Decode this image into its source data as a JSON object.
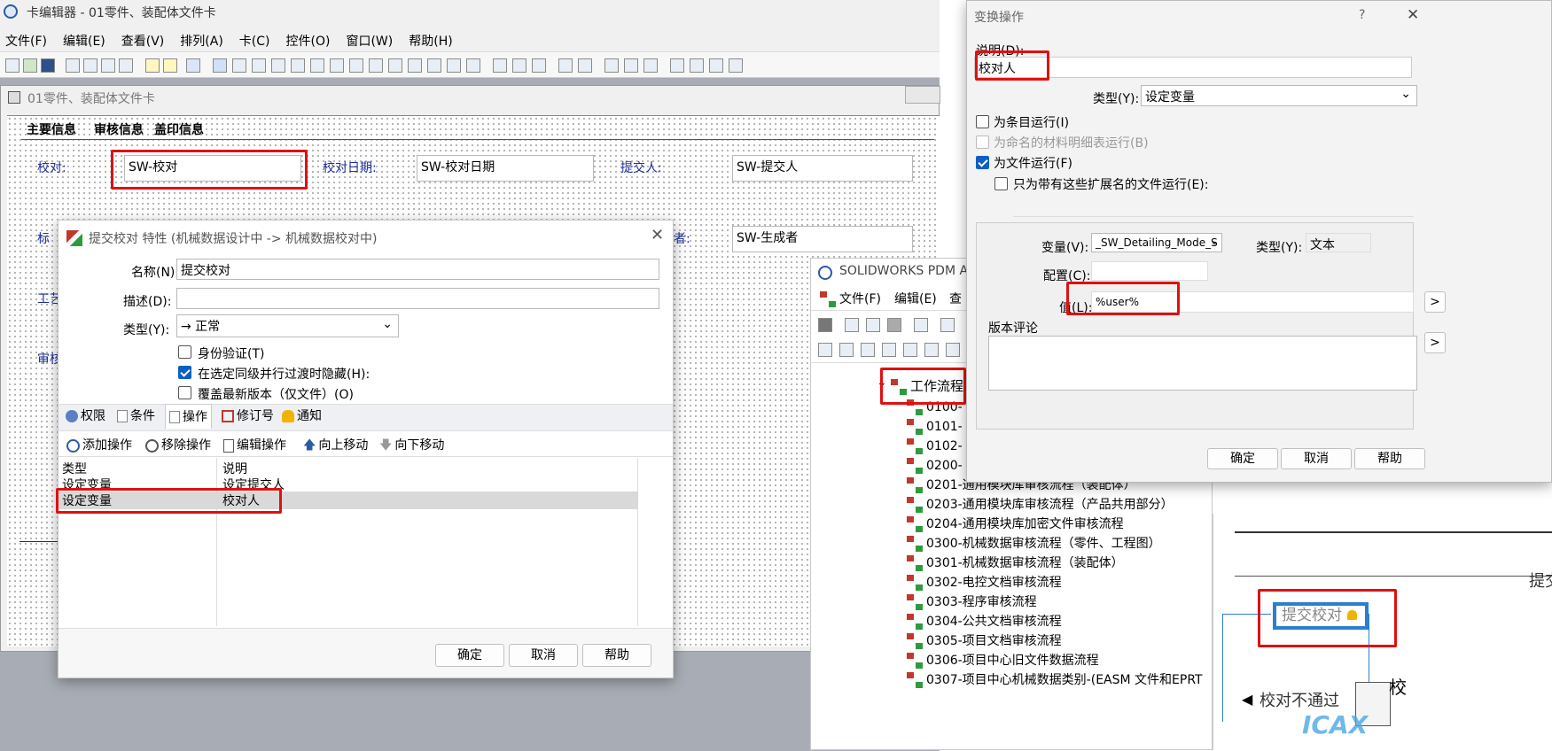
{
  "main_window": {
    "title": "卡编辑器 - 01零件、装配体文件卡",
    "menu": [
      "文件(F)",
      "编辑(E)",
      "查看(V)",
      "排列(A)",
      "卡(C)",
      "控件(O)",
      "窗口(W)",
      "帮助(H)"
    ],
    "inner_title": "01零件、装配体文件卡"
  },
  "card": {
    "tabs": [
      "主要信息",
      "审核信息",
      "盖印信息"
    ],
    "fields": [
      {
        "label": "校对:",
        "value": "SW-校对"
      },
      {
        "label": "校对日期:",
        "value": "SW-校对日期"
      },
      {
        "label": "提交人:",
        "value": "SW-提交人"
      },
      {
        "label": "标",
        "value": ""
      },
      {
        "label": "者:",
        "value": "SW-生成者"
      },
      {
        "label": "工艺",
        "value": ""
      },
      {
        "label": "审核",
        "value": ""
      }
    ]
  },
  "transition_dialog": {
    "title": "提交校对 特性 (机械数据设计中 -> 机械数据校对中)",
    "name_label": "名称(N):",
    "name_value": "提交校对",
    "desc_label": "描述(D):",
    "desc_value": "",
    "type_label": "类型(Y):",
    "type_value": "→ 正常",
    "checkboxes": [
      {
        "label": "身份验证(T)",
        "checked": false
      },
      {
        "label": "在选定同级并行过渡时隐藏(H):",
        "checked": true
      },
      {
        "label": "覆盖最新版本（仅文件）(O)",
        "checked": false
      }
    ],
    "tabs": [
      "权限",
      "条件",
      "操作",
      "修订号",
      "通知"
    ],
    "actions": [
      "添加操作",
      "移除操作",
      "编辑操作",
      "向上移动",
      "向下移动"
    ],
    "table": {
      "headers": [
        "类型",
        "说明"
      ],
      "rows": [
        [
          "设定变量",
          "设定提交人"
        ],
        [
          "设定变量",
          "校对人"
        ]
      ]
    },
    "buttons": [
      "确定",
      "取消",
      "帮助"
    ]
  },
  "pdm_window": {
    "title": "SOLIDWORKS PDM Adı",
    "menu": [
      "文件(F)",
      "编辑(E)",
      "查"
    ],
    "tree_root": "工作流程",
    "tree_items": [
      "0100-",
      "0101-",
      "0102-",
      "0200-",
      "0201-通用模块库审核流程（装配体）",
      "0203-通用模块库审核流程（产品共用部分）",
      "0204-通用模块库加密文件审核流程",
      "0300-机械数据审核流程（零件、工程图）",
      "0301-机械数据审核流程（装配体）",
      "0302-电控文档审核流程",
      "0303-程序审核流程",
      "0304-公共文档审核流程",
      "0305-项目文档审核流程",
      "0306-项目中心旧文件数据流程",
      "0307-项目中心机械数据类别-(EASM 文件和EPRT"
    ]
  },
  "workflow": {
    "node": "提交校对",
    "left_text": "校对不通过",
    "top_right": "提交",
    "right_char": "校"
  },
  "task_dialog": {
    "title": "变换操作",
    "help": "?",
    "close": "✕",
    "desc_label": "说明(D):",
    "desc_value": "校对人",
    "type_label": "类型(Y):",
    "type_value": "设定变量",
    "checkboxes": [
      {
        "label": "为条目运行(I)",
        "checked": false,
        "disabled": false
      },
      {
        "label": "为命名的材料明细表运行(B)",
        "checked": false,
        "disabled": true
      },
      {
        "label": "为文件运行(F)",
        "checked": true,
        "disabled": false
      },
      {
        "label": "只为带有这些扩展名的文件运行(E):",
        "checked": false,
        "disabled": false
      }
    ],
    "var_label": "变量(V):",
    "var_value": "_SW_Detailing_Mode_S",
    "vtype_label": "类型(Y):",
    "vtype_value": "文本",
    "config_label": "配置(C):",
    "config_value": "",
    "value_label": "值(L):",
    "value_value": "%user%",
    "comment_label": "版本评论",
    "more": ">",
    "buttons": [
      "确定",
      "取消",
      "帮助"
    ]
  },
  "watermark": "ICAX"
}
